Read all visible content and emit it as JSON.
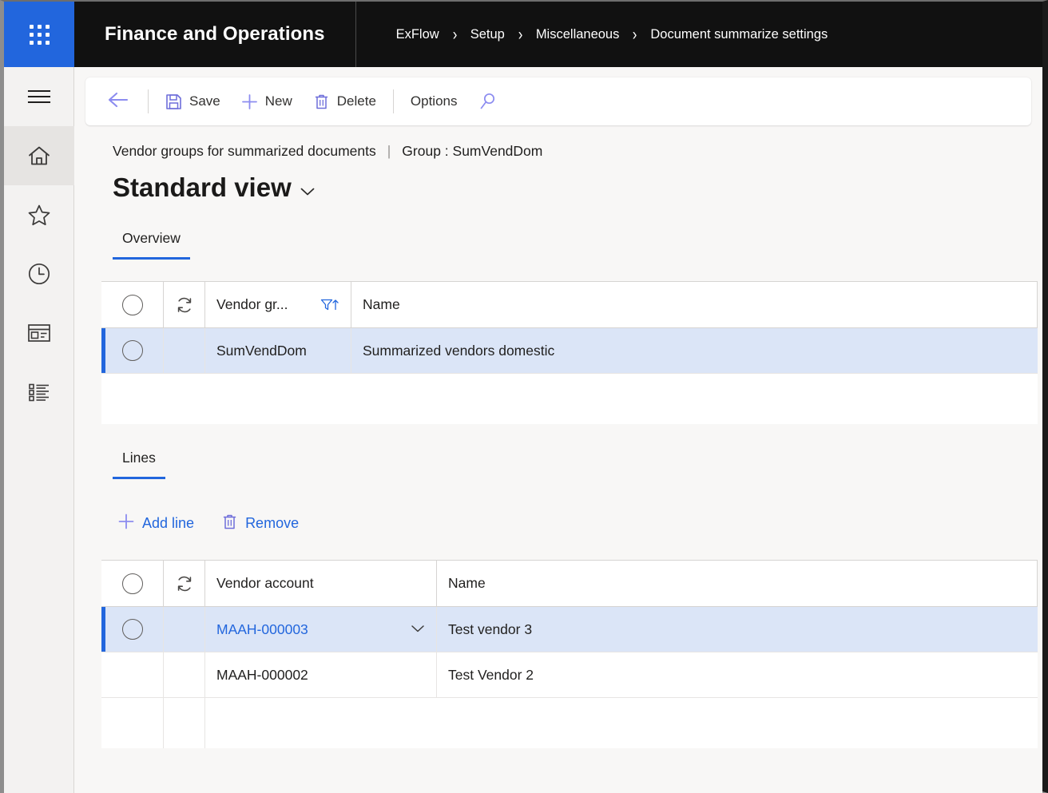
{
  "topbar": {
    "waffle_label": "app-launcher",
    "app_title": "Finance and Operations",
    "breadcrumb": [
      {
        "label": "ExFlow"
      },
      {
        "label": "Setup"
      },
      {
        "label": "Miscellaneous"
      },
      {
        "label": "Document summarize settings"
      }
    ],
    "chevron": "›"
  },
  "sidebar": {
    "items": [
      {
        "icon": "hamburger-menu-icon",
        "name": "navigation-menu",
        "active": false
      },
      {
        "icon": "home-icon",
        "name": "home",
        "active": true
      },
      {
        "icon": "star-icon",
        "name": "favorites",
        "active": false
      },
      {
        "icon": "clock-icon",
        "name": "recent",
        "active": false
      },
      {
        "icon": "workspace-icon",
        "name": "workspaces",
        "active": false
      },
      {
        "icon": "list-icon",
        "name": "modules",
        "active": false
      }
    ]
  },
  "toolbar": {
    "back_label": "Back",
    "save_label": "Save",
    "new_label": "New",
    "delete_label": "Delete",
    "options_label": "Options",
    "search_label": "Search"
  },
  "caption": {
    "primary": "Vendor groups for summarized documents",
    "separator": "|",
    "secondary": "Group : SumVendDom",
    "title": "Standard view",
    "title_chevron": "⌄"
  },
  "overview": {
    "tab_label": "Overview",
    "columns": [
      "",
      "",
      "Vendor gr...",
      "Name"
    ],
    "rows": [
      {
        "code": "SumVendDom",
        "name": "Summarized vendors domestic",
        "selected": true
      }
    ]
  },
  "lines": {
    "tab_label": "Lines",
    "add_line_label": "Add line",
    "remove_label": "Remove",
    "columns": [
      "",
      "",
      "Vendor account",
      "Name"
    ],
    "rows": [
      {
        "code": "MAAH-000003",
        "name": "Test vendor 3",
        "selected": true,
        "has_lookup": true
      },
      {
        "code": "MAAH-000002",
        "name": "Test Vendor 2",
        "selected": false,
        "has_lookup": false
      }
    ]
  },
  "colors": {
    "accent": "#2266dd",
    "topbar_bg": "#111111",
    "page_bg": "#f8f7f6",
    "row_selected": "#dbe5f7"
  }
}
